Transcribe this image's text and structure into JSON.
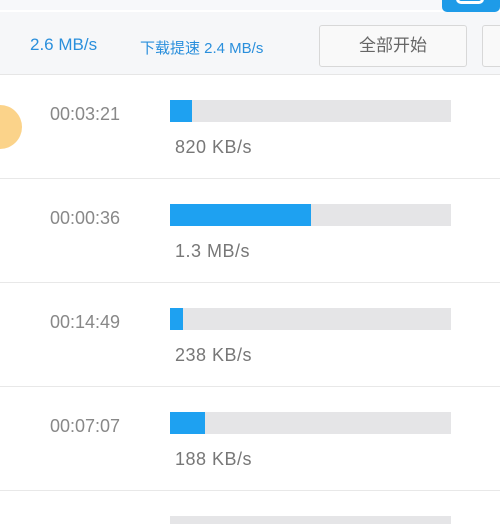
{
  "header": {
    "download_speed": "2.6 MB/s",
    "boost_speed": "下载提速 2.4 MB/s",
    "start_all_label": "全部开始"
  },
  "colors": {
    "accent": "#1ea1f1",
    "text_blue": "#2a8fdc",
    "track": "#e5e5e7",
    "avatar": "#fbd38a"
  },
  "tasks": [
    {
      "time_remaining": "00:03:21",
      "speed": "820 KB/s",
      "progress": 0.08
    },
    {
      "time_remaining": "00:00:36",
      "speed": "1.3 MB/s",
      "progress": 0.5
    },
    {
      "time_remaining": "00:14:49",
      "speed": "238 KB/s",
      "progress": 0.045
    },
    {
      "time_remaining": "00:07:07",
      "speed": "188 KB/s",
      "progress": 0.125
    }
  ]
}
